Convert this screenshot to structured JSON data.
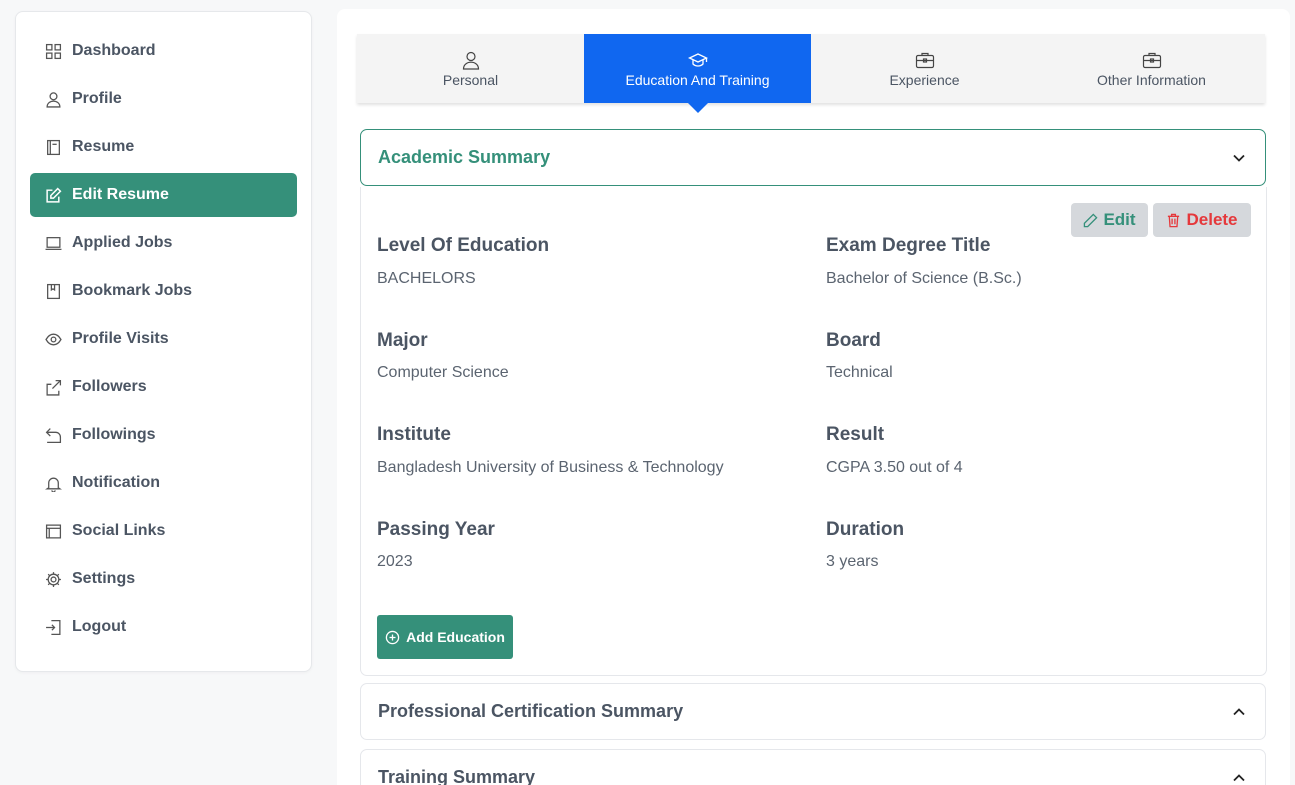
{
  "sidebar": {
    "items": [
      {
        "label": "Dashboard",
        "icon": "grid-icon"
      },
      {
        "label": "Profile",
        "icon": "user-icon"
      },
      {
        "label": "Resume",
        "icon": "book-icon"
      },
      {
        "label": "Edit Resume",
        "icon": "edit-icon",
        "active": true
      },
      {
        "label": "Applied Jobs",
        "icon": "laptop-icon"
      },
      {
        "label": "Bookmark Jobs",
        "icon": "bookmark-icon"
      },
      {
        "label": "Profile Visits",
        "icon": "eye-icon"
      },
      {
        "label": "Followers",
        "icon": "share-icon"
      },
      {
        "label": "Followings",
        "icon": "reply-icon"
      },
      {
        "label": "Notification",
        "icon": "bell-icon"
      },
      {
        "label": "Social Links",
        "icon": "window-icon"
      },
      {
        "label": "Settings",
        "icon": "gear-icon"
      },
      {
        "label": "Logout",
        "icon": "logout-icon"
      }
    ]
  },
  "tabs": [
    {
      "label": "Personal",
      "icon": "user-icon"
    },
    {
      "label": "Education And Training",
      "icon": "graduation-cap-icon",
      "active": true
    },
    {
      "label": "Experience",
      "icon": "briefcase-icon"
    },
    {
      "label": "Other Information",
      "icon": "briefcase-icon"
    }
  ],
  "academic": {
    "title": "Academic Summary",
    "edit_label": "Edit",
    "delete_label": "Delete",
    "fields": {
      "level_label": "Level Of Education",
      "level_value": "BACHELORS",
      "degree_label": "Exam Degree Title",
      "degree_value": "Bachelor of Science (B.Sc.)",
      "major_label": "Major",
      "major_value": "Computer Science",
      "board_label": "Board",
      "board_value": "Technical",
      "institute_label": "Institute",
      "institute_value": "Bangladesh University of Business & Technology",
      "result_label": "Result",
      "result_value": "CGPA 3.50 out of 4",
      "year_label": "Passing Year",
      "year_value": "2023",
      "duration_label": "Duration",
      "duration_value": "3 years"
    },
    "add_label": "Add Education"
  },
  "sections": {
    "certification_title": "Professional Certification Summary",
    "training_title": "Training Summary"
  },
  "colors": {
    "brand": "#35907a",
    "tab_active": "#1067f0",
    "danger": "#e5383b"
  }
}
